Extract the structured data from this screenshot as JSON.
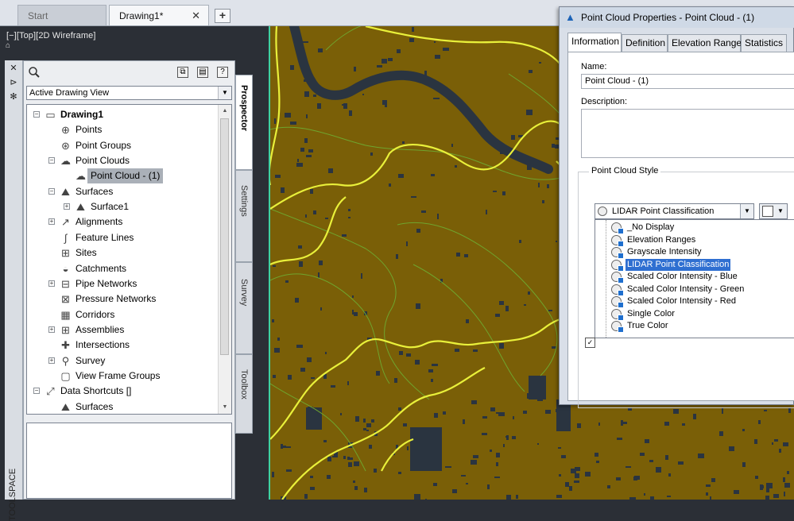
{
  "tabs": {
    "start": "Start",
    "drawing": "Drawing1*",
    "close": "✕",
    "plus": "+"
  },
  "viewport": {
    "label": "[−][Top][2D Wireframe]"
  },
  "toolspace": {
    "vertical_title": "TOOLSPACE",
    "view_select": "Active Drawing View",
    "tabs": [
      "Prospector",
      "Settings",
      "Survey",
      "Toolbox"
    ],
    "tree": [
      {
        "label": "Drawing1",
        "icon": "drawing-icon",
        "level": 0,
        "expander": "−",
        "bold": true
      },
      {
        "label": "Points",
        "icon": "points-icon",
        "level": 1,
        "expander": ""
      },
      {
        "label": "Point Groups",
        "icon": "point-groups-icon",
        "level": 1,
        "expander": ""
      },
      {
        "label": "Point Clouds",
        "icon": "point-clouds-icon",
        "level": 1,
        "expander": "−"
      },
      {
        "label": "Point Cloud - (1)",
        "icon": "point-cloud-icon",
        "level": 2,
        "expander": "",
        "selected": true
      },
      {
        "label": "Surfaces",
        "icon": "surfaces-icon",
        "level": 1,
        "expander": "−"
      },
      {
        "label": "Surface1",
        "icon": "surface-icon",
        "level": 2,
        "expander": "+"
      },
      {
        "label": "Alignments",
        "icon": "alignments-icon",
        "level": 1,
        "expander": "+"
      },
      {
        "label": "Feature Lines",
        "icon": "feature-lines-icon",
        "level": 1,
        "expander": ""
      },
      {
        "label": "Sites",
        "icon": "sites-icon",
        "level": 1,
        "expander": ""
      },
      {
        "label": "Catchments",
        "icon": "catchments-icon",
        "level": 1,
        "expander": ""
      },
      {
        "label": "Pipe Networks",
        "icon": "pipe-networks-icon",
        "level": 1,
        "expander": "+"
      },
      {
        "label": "Pressure Networks",
        "icon": "pressure-networks-icon",
        "level": 1,
        "expander": ""
      },
      {
        "label": "Corridors",
        "icon": "corridors-icon",
        "level": 1,
        "expander": ""
      },
      {
        "label": "Assemblies",
        "icon": "assemblies-icon",
        "level": 1,
        "expander": "+"
      },
      {
        "label": "Intersections",
        "icon": "intersections-icon",
        "level": 1,
        "expander": ""
      },
      {
        "label": "Survey",
        "icon": "survey-icon",
        "level": 1,
        "expander": "+"
      },
      {
        "label": "View Frame Groups",
        "icon": "view-frame-groups-icon",
        "level": 1,
        "expander": ""
      },
      {
        "label": "Data Shortcuts []",
        "icon": "data-shortcuts-icon",
        "level": 0,
        "expander": "−"
      },
      {
        "label": "Surfaces",
        "icon": "surfaces-icon",
        "level": 1,
        "expander": ""
      }
    ]
  },
  "dialog": {
    "title": "Point Cloud Properties - Point Cloud - (1)",
    "tabs": [
      "Information",
      "Definition",
      "Elevation Ranges",
      "Statistics"
    ],
    "name_label": "Name:",
    "name_value": "Point Cloud - (1)",
    "description_label": "Description:",
    "description_value": "",
    "group_label": "Point Cloud Style",
    "style_value": "LIDAR Point Classification",
    "style_options": [
      "_No Display",
      "Elevation Ranges",
      "Grayscale Intensity",
      "LIDAR Point Classification",
      "Scaled Color Intensity - Blue",
      "Scaled Color Intensity - Green",
      "Scaled Color Intensity - Red",
      "Single Color",
      "True Color"
    ],
    "selected_option": 3,
    "checkbox_checked": true
  },
  "colors": {
    "map_fill": "#7a5f07",
    "contour_major": "#e9f03a",
    "contour_minor": "#6fa52e",
    "building": "#2a3440",
    "selection": "#2f6fd1"
  }
}
